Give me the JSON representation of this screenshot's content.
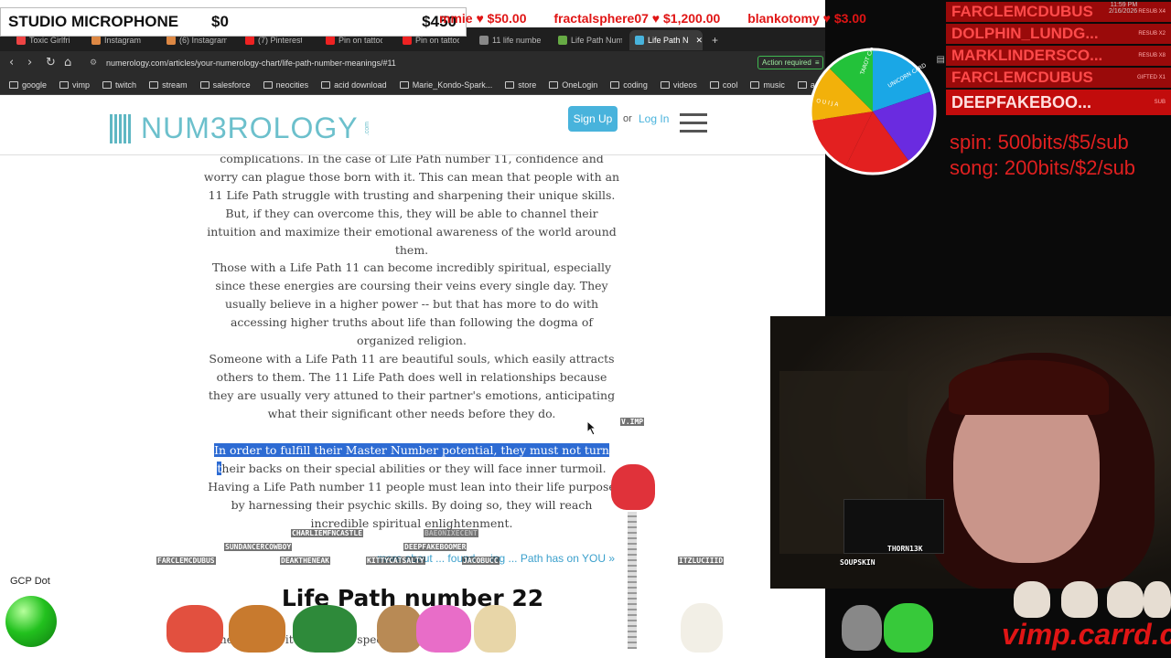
{
  "overlay": {
    "studio_mic": {
      "label": "STUDIO MICROPHONE",
      "left_amount": "$0",
      "right_amount": "$450"
    },
    "ticker": [
      {
        "name": "mmie",
        "amount": "$50.00"
      },
      {
        "name": "fractalsphere07",
        "amount": "$1,200.00"
      },
      {
        "name": "blankotomy",
        "amount": "$3.00"
      }
    ],
    "clock": {
      "time": "11:59 PM",
      "date": "2/16/2026"
    },
    "recent_subs": [
      {
        "name": "FARCLEMCDUBUS",
        "note": "RESUB X4"
      },
      {
        "name": "DOLPHIN_LUNDG...",
        "note": "RESUB X2"
      },
      {
        "name": "MARKLINDERSCO...",
        "note": "RESUB X8"
      },
      {
        "name": "FARCLEMCDUBUS",
        "note": "GIFTED X1"
      },
      {
        "name": "DEEPFAKEBOO...",
        "note": "SUB"
      }
    ],
    "spin_text": "spin: 500bits/$5/sub",
    "song_text": "song: 200bits/$2/sub",
    "wheel_labels": [
      "TAROT CARD",
      "UNICORN CARD",
      "O U I J A"
    ],
    "gcp_label": "GCP Dot",
    "vimp_link": "vimp.carrd.co",
    "cam_labels": [
      "THORN13K",
      "SOUPSKIN"
    ],
    "chatters": [
      "CHARLIEMFNCASTLE",
      "BAEONIXECENT",
      "SUNDANCERCOWBOY",
      "DEEPFAKEBOOMER",
      "FARCLEMCDUBUS",
      "DEAKTHENEAK",
      "KITTYCATSALTY",
      "JACOBUCC",
      "ITZLUCIIID",
      "V.IMP"
    ],
    "accent_red": "#e01515"
  },
  "browser": {
    "tabs": [
      {
        "label": "Toxic Girlfri",
        "color": "#e44"
      },
      {
        "label": "Instagram",
        "color": "#d84"
      },
      {
        "label": "(6) Instagram",
        "color": "#d84"
      },
      {
        "label": "(7) Pinterest",
        "color": "#e22"
      },
      {
        "label": "Pin on tattoo",
        "color": "#e22"
      },
      {
        "label": "Pin on tattoo",
        "color": "#e22"
      },
      {
        "label": "11 life numbe",
        "color": "#888"
      },
      {
        "label": "Life Path Num",
        "color": "#6a4"
      },
      {
        "label": "Life Path N",
        "color": "#48b3dc"
      }
    ],
    "url": "numerology.com/articles/your-numerology-chart/life-path-number-meanings/#11",
    "action_required": "Action required",
    "bookmarks": [
      "google",
      "vimp",
      "twitch",
      "stream",
      "salesforce",
      "neocities",
      "acid download",
      "Marie_Kondo-Spark...",
      "store",
      "OneLogin",
      "coding",
      "videos",
      "cool",
      "music",
      "art"
    ]
  },
  "site": {
    "logo_text": "NUM3ROLOGY",
    "logo_suffix": ".com",
    "signup": "Sign Up",
    "or": "or",
    "login": "Log In"
  },
  "article": {
    "para1": "complications. In the case of Life Path number 11, confidence and worry can plague those born with it. This can mean that people with an 11 Life Path struggle with trusting and sharpening their unique skills. But, if they can overcome this, they will be able to channel their intuition and maximize their emotional awareness of the world around them.",
    "para2": "Those with a Life Path 11 can become incredibly spiritual, especially since these energies are coursing their veins every single day. They usually believe in a higher power -- but that has more to do with accessing higher truths about life than following the dogma of organized religion.",
    "para3": "Someone with a Life Path 11 are beautiful souls, which easily attracts others to them. The 11 Life Path does well in relationships because they are usually very attuned to their partner's emotions, anticipating what their significant other needs before they do.",
    "para4_highlight": "In order to fulfill their Master Number potential, they must not turn t",
    "para4_rest": "heir backs on their special abilities or they will face inner turmoil. Having a Life Path number 11 people must lean into their life purpose by harnessing their psychic skills. By doing so, they will reach incredible spiritual enlightenment.",
    "more_link": "more about ... found ... ing ... Path has on YOU »",
    "heading": "Life Path number 22",
    "body22": "The ... 'Ma... it has a very special"
  }
}
